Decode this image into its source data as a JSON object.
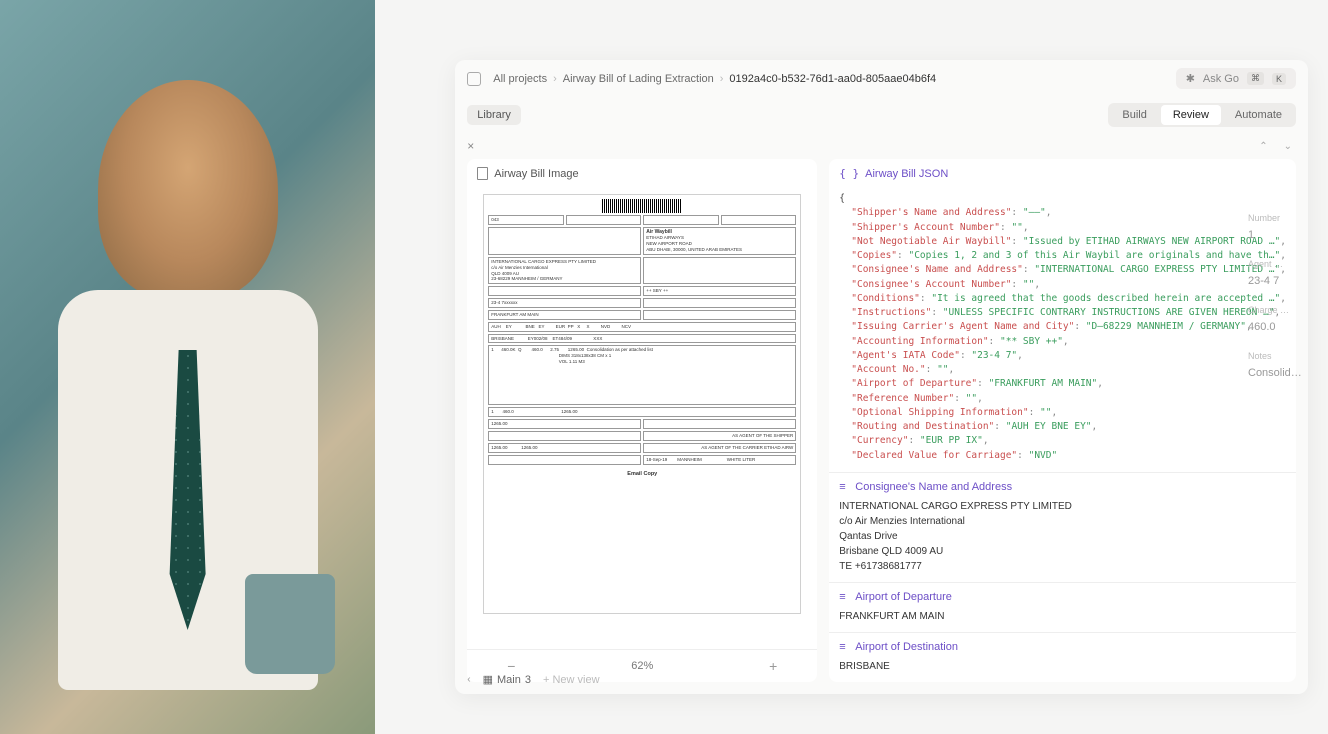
{
  "breadcrumb": {
    "root": "All projects",
    "project": "Airway Bill of Lading Extraction",
    "current": "0192a4c0-b532-76d1-aa0d-805aae04b6f4"
  },
  "ask_go": {
    "label": "Ask Go",
    "kbd1": "⌘",
    "kbd2": "K",
    "bolt": "✱"
  },
  "library": "Library",
  "tabs": {
    "build": "Build",
    "review": "Review",
    "automate": "Automate"
  },
  "doc_pane": {
    "title": "Airway Bill Image",
    "zoom": "62%",
    "email_copy": "Email Copy"
  },
  "waybill": {
    "code": "043",
    "title": "Air Waybill",
    "issuer": "ETIHAD AIRWAYS\nNEW AIRPORT ROAD\nABU DHABI, 30000, UNITED ARAB EMIRATES",
    "shipper1": "INTERNATIONAL CARGO EXPRESS PTY LIMITED",
    "shipper2": "c/o Air Menzies International",
    "shipper3": "QLD 4009 AU",
    "shipper4": "23-68229 MANNHEIM / GERMANY",
    "iata": "23-4 7xxxxxx",
    "dep": "FRANKFURT AM MAIN",
    "codes": "AUH    EY           BNE   EY         EUR  PP   X     X         NVD         NCV",
    "dest_line": "BRISBANE           EY002/08    ET484/09                 XXX",
    "sby": "++ SBY ++",
    "cargo_line": "1      460.0K  Q        460.0      2.75       1265.00  Consolidation as per attached list\n                                                      DIMS 318x138x38 CM x 1\n                                                      VOL 1.11 M3",
    "tot1": "1       460.0                                      1265.00",
    "tot2": "1265.00",
    "tot3": "1265.00           1265.00",
    "agent1": "AS AGENT OF THE SHIPPER",
    "agent2": "AS AGENT OF THE CARRIER ETIHAD AIRW",
    "date_line": "18-Sep-19        MANNHEIM                    WHITE LITER"
  },
  "json_pane": {
    "title": "Airway Bill JSON",
    "lines": [
      {
        "k": "Shipper's Name and Address",
        "v": "\"——\""
      },
      {
        "k": "Shipper's Account Number",
        "v": "\"\""
      },
      {
        "k": "Not Negotiable Air Waybill",
        "v": "\"Issued by ETIHAD AIRWAYS NEW AIRPORT ROAD …\""
      },
      {
        "k": "Copies",
        "v": "\"Copies 1, 2 and 3 of this Air Waybil are originals and have th…\""
      },
      {
        "k": "Consignee's Name and Address",
        "v": "\"INTERNATIONAL CARGO EXPRESS PTY LIMITED …\""
      },
      {
        "k": "Consignee's Account Number",
        "v": "\"\""
      },
      {
        "k": "Conditions",
        "v": "\"It is agreed that the goods described herein are accepted …\""
      },
      {
        "k": "Instructions",
        "v": "\"UNLESS SPECIFIC CONTRARY INSTRUCTIONS ARE GIVEN HEREON …\""
      },
      {
        "k": "Issuing Carrier's Agent Name and City",
        "v": "\"D—68229 MANNHEIM / GERMANY\""
      },
      {
        "k": "Accounting Information",
        "v": "\"** SBY ++\""
      },
      {
        "k": "Agent's IATA Code",
        "v": "\"23-4 7\""
      },
      {
        "k": "Account No.",
        "v": "\"\""
      },
      {
        "k": "Airport of Departure",
        "v": "\"FRANKFURT AM MAIN\""
      },
      {
        "k": "Reference Number",
        "v": "\"\""
      },
      {
        "k": "Optional Shipping Information",
        "v": "\"\""
      },
      {
        "k": "Routing and Destination",
        "v": "\"AUH EY BNE EY\""
      },
      {
        "k": "Currency",
        "v": "\"EUR PP IX\""
      },
      {
        "k": "Declared Value for Carriage",
        "v": "\"NVD\""
      }
    ]
  },
  "extracts": [
    {
      "title": "Consignee's Name and Address",
      "lines": [
        "INTERNATIONAL CARGO EXPRESS PTY LIMITED",
        "c/o Air Menzies International",
        "Qantas Drive",
        "Brisbane QLD 4009 AU",
        "TE +61738681777"
      ]
    },
    {
      "title": "Airport of Departure",
      "lines": [
        "FRANKFURT AM MAIN"
      ]
    },
    {
      "title": "Airport of Destination",
      "lines": [
        "BRISBANE"
      ]
    }
  ],
  "ghost": {
    "num_label": "Number",
    "num_val": "1",
    "agent_label": "Agent …",
    "agent_val": "23-4 7",
    "charge_label": "Charge …",
    "charge_val": "460.0",
    "notes_label": "Notes",
    "notes_val": "Consolid…"
  },
  "footer": {
    "main": "Main",
    "count": "3",
    "new_view": "New view"
  }
}
